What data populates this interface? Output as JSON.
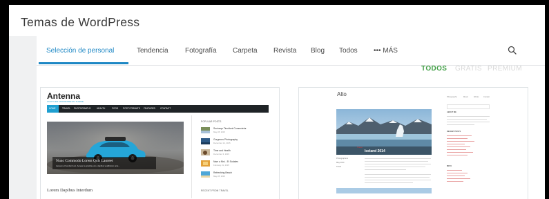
{
  "page": {
    "title": "Temas de WordPress"
  },
  "nav": {
    "tabs": [
      {
        "label": "Selección de personal",
        "active": true
      },
      {
        "label": "Tendencia"
      },
      {
        "label": "Fotografía"
      },
      {
        "label": "Carpeta"
      },
      {
        "label": "Revista"
      },
      {
        "label": "Blog"
      },
      {
        "label": "Todos"
      },
      {
        "label": "••• MÁS"
      }
    ],
    "search_icon": "search-icon"
  },
  "filters": [
    {
      "label": "TODOS",
      "active": true
    },
    {
      "label": "GRATIS"
    },
    {
      "label": "PREMIUM"
    }
  ],
  "themes": [
    {
      "name": "Antenna",
      "tagline": "ANOTHER WORDPRESS THEME",
      "menu": [
        "HOME",
        "TRAVEL",
        "PHOTOGRAPHY",
        "HEALTH",
        "FOOD",
        "POST FORMATS",
        "FEATURED",
        "CONTACT"
      ],
      "hero_title": "Nunc Commodo Lorem Quis Laoreet",
      "hero_excerpt": "Aenean et hendrerit est. Aenean a gravida eros, dapibus vestibulum ante...",
      "sidebar_heading": "POPULAR POSTS",
      "popular_posts": [
        {
          "title": "Sociosqu Tincidunt Consectetur",
          "date": "May 28, 2015"
        },
        {
          "title": "Gorgeous Photography",
          "date": "December 14, 2015"
        },
        {
          "title": "Time and Health",
          "date": "December 3, 2015"
        },
        {
          "title": "Nam a Nisi - Et Sodales",
          "date": "February 21, 2015"
        },
        {
          "title": "Refreshing Beach",
          "date": "May 28, 2015"
        }
      ],
      "bottom_title": "Lorem Dapibus Interdum",
      "recent_heading": "RECENT FROM TRAVEL"
    },
    {
      "name": "Alto",
      "menu": [
        "Photographs",
        "Music",
        "Works",
        "Contact"
      ],
      "hero_category": "Travel",
      "hero_title": "Iceland 2014",
      "meta": [
        "Photographers",
        "May 2014",
        "Travel"
      ],
      "sidebar_headings": [
        "ABOUT ME",
        "RECENT POSTS",
        "META"
      ]
    }
  ],
  "colors": {
    "accent_blue": "#1d87c4",
    "filter_active": "#43a047",
    "filter_inactive": "#d8d8d8",
    "antenna_nav": "#1f2326",
    "antenna_accent": "#1e9fd0",
    "alto_link": "#d73a3a"
  }
}
